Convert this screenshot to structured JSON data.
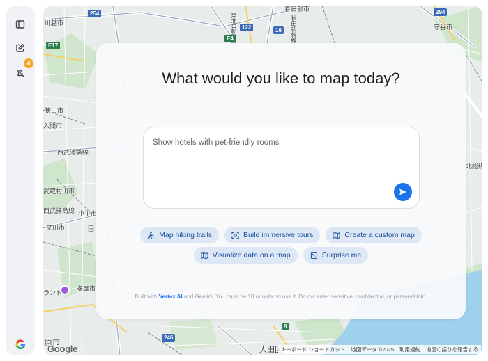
{
  "sidebar": {
    "toggle_icon": "sidebar-toggle-icon",
    "new_chat_icon": "edit-icon",
    "notifications_icon": "bell-off-icon",
    "notifications_count": "4",
    "google_icon": "google-g-icon"
  },
  "panel": {
    "title": "What would you like to map today?",
    "prompt_placeholder": "Show hotels with pet-friendly rooms",
    "chips": [
      {
        "label": "Map hiking trails",
        "icon": "hiking-icon"
      },
      {
        "label": "Build immersive tours",
        "icon": "tour-icon"
      },
      {
        "label": "Create a custom map",
        "icon": "map-icon"
      },
      {
        "label": "Visualize data on a map",
        "icon": "map-icon"
      },
      {
        "label": "Surprise me",
        "icon": "dice-icon"
      }
    ],
    "disclaimer_prefix": "Built with",
    "disclaimer_brand": "Vertex AI",
    "disclaimer_rest": "and Gemini. You must be 18 or older to use it. Do not enter sensitive, confidential, or personal info."
  },
  "map": {
    "labels": {
      "kasukabe": "春日部市",
      "moriya": "守谷市",
      "kitasoma": "北総線",
      "sayama": "狭山市",
      "iruma": "入間市",
      "nishibu": "西武池袋線",
      "higashimurayama": "東大和市",
      "musashi": "武蔵村山市",
      "seibutamako": "西武拝島線",
      "kodaira": "小平市",
      "tachikawa": "立川市",
      "tama": "多摩市",
      "land": "ランド",
      "genshi": "原市",
      "ota": "大田区",
      "tohoku": "東北自動車道",
      "akita": "秋田新幹線",
      "kawagoe": "川越市",
      "kotohira": "国"
    },
    "shields": [
      "254",
      "E17",
      "E4",
      "122",
      "16",
      "294",
      "246",
      "8"
    ],
    "footer": [
      "キーボード ショートカット",
      "地図データ ©2025",
      "利用規約",
      "地図の誤りを報告する"
    ],
    "google": "Google"
  }
}
